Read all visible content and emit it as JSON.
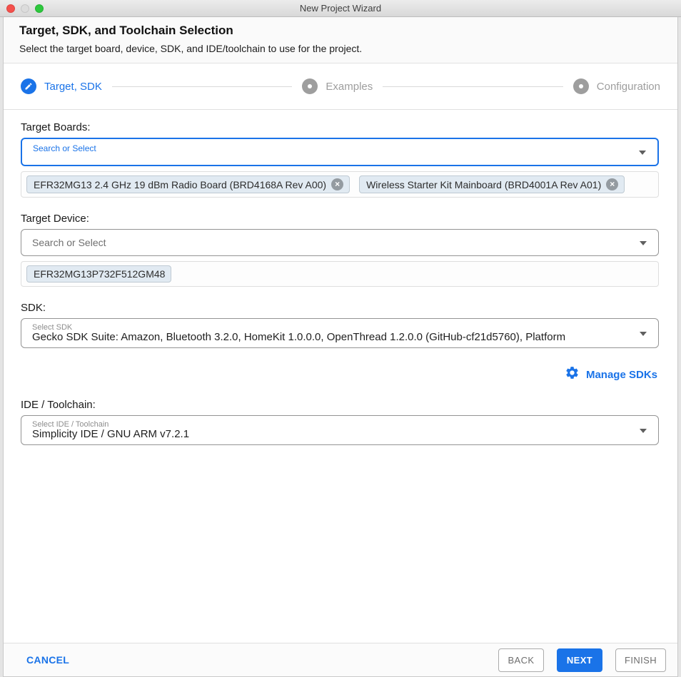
{
  "window": {
    "title": "New Project Wizard"
  },
  "header": {
    "title": "Target, SDK, and Toolchain Selection",
    "subtitle": "Select the target board, device, SDK, and IDE/toolchain to use for the project."
  },
  "stepper": {
    "steps": [
      {
        "label": "Target, SDK",
        "state": "active",
        "icon": "pencil-icon"
      },
      {
        "label": "Examples",
        "state": "upcoming",
        "icon": "dot-icon"
      },
      {
        "label": "Configuration",
        "state": "upcoming",
        "icon": "dot-icon"
      }
    ]
  },
  "form": {
    "target_boards": {
      "label": "Target Boards:",
      "placeholder": "Search or Select",
      "chips": [
        {
          "text": "EFR32MG13 2.4 GHz 19 dBm Radio Board (BRD4168A Rev A00)",
          "removable": true
        },
        {
          "text": "Wireless Starter Kit Mainboard (BRD4001A Rev A01)",
          "removable": true
        }
      ]
    },
    "target_device": {
      "label": "Target Device:",
      "placeholder": "Search or Select",
      "chips": [
        {
          "text": "EFR32MG13P732F512GM48",
          "removable": false
        }
      ]
    },
    "sdk": {
      "label": "SDK:",
      "select_label": "Select SDK",
      "value": "Gecko SDK Suite: Amazon, Bluetooth 3.2.0, HomeKit 1.0.0.0, OpenThread 1.2.0.0 (GitHub-cf21d5760), Platform",
      "manage_label": "Manage SDKs"
    },
    "ide_toolchain": {
      "label": "IDE / Toolchain:",
      "select_label": "Select IDE / Toolchain",
      "value": "Simplicity IDE / GNU ARM v7.2.1"
    }
  },
  "footer": {
    "cancel_label": "CANCEL",
    "back_label": "BACK",
    "next_label": "NEXT",
    "finish_label": "FINISH"
  },
  "colors": {
    "accent_blue": "#1a73e8",
    "step_inactive_gray": "#9e9e9e",
    "chip_background": "#e1eaf2",
    "close_red": "#f4504c",
    "maximize_green": "#2dc83d"
  },
  "close_glyph": "×"
}
